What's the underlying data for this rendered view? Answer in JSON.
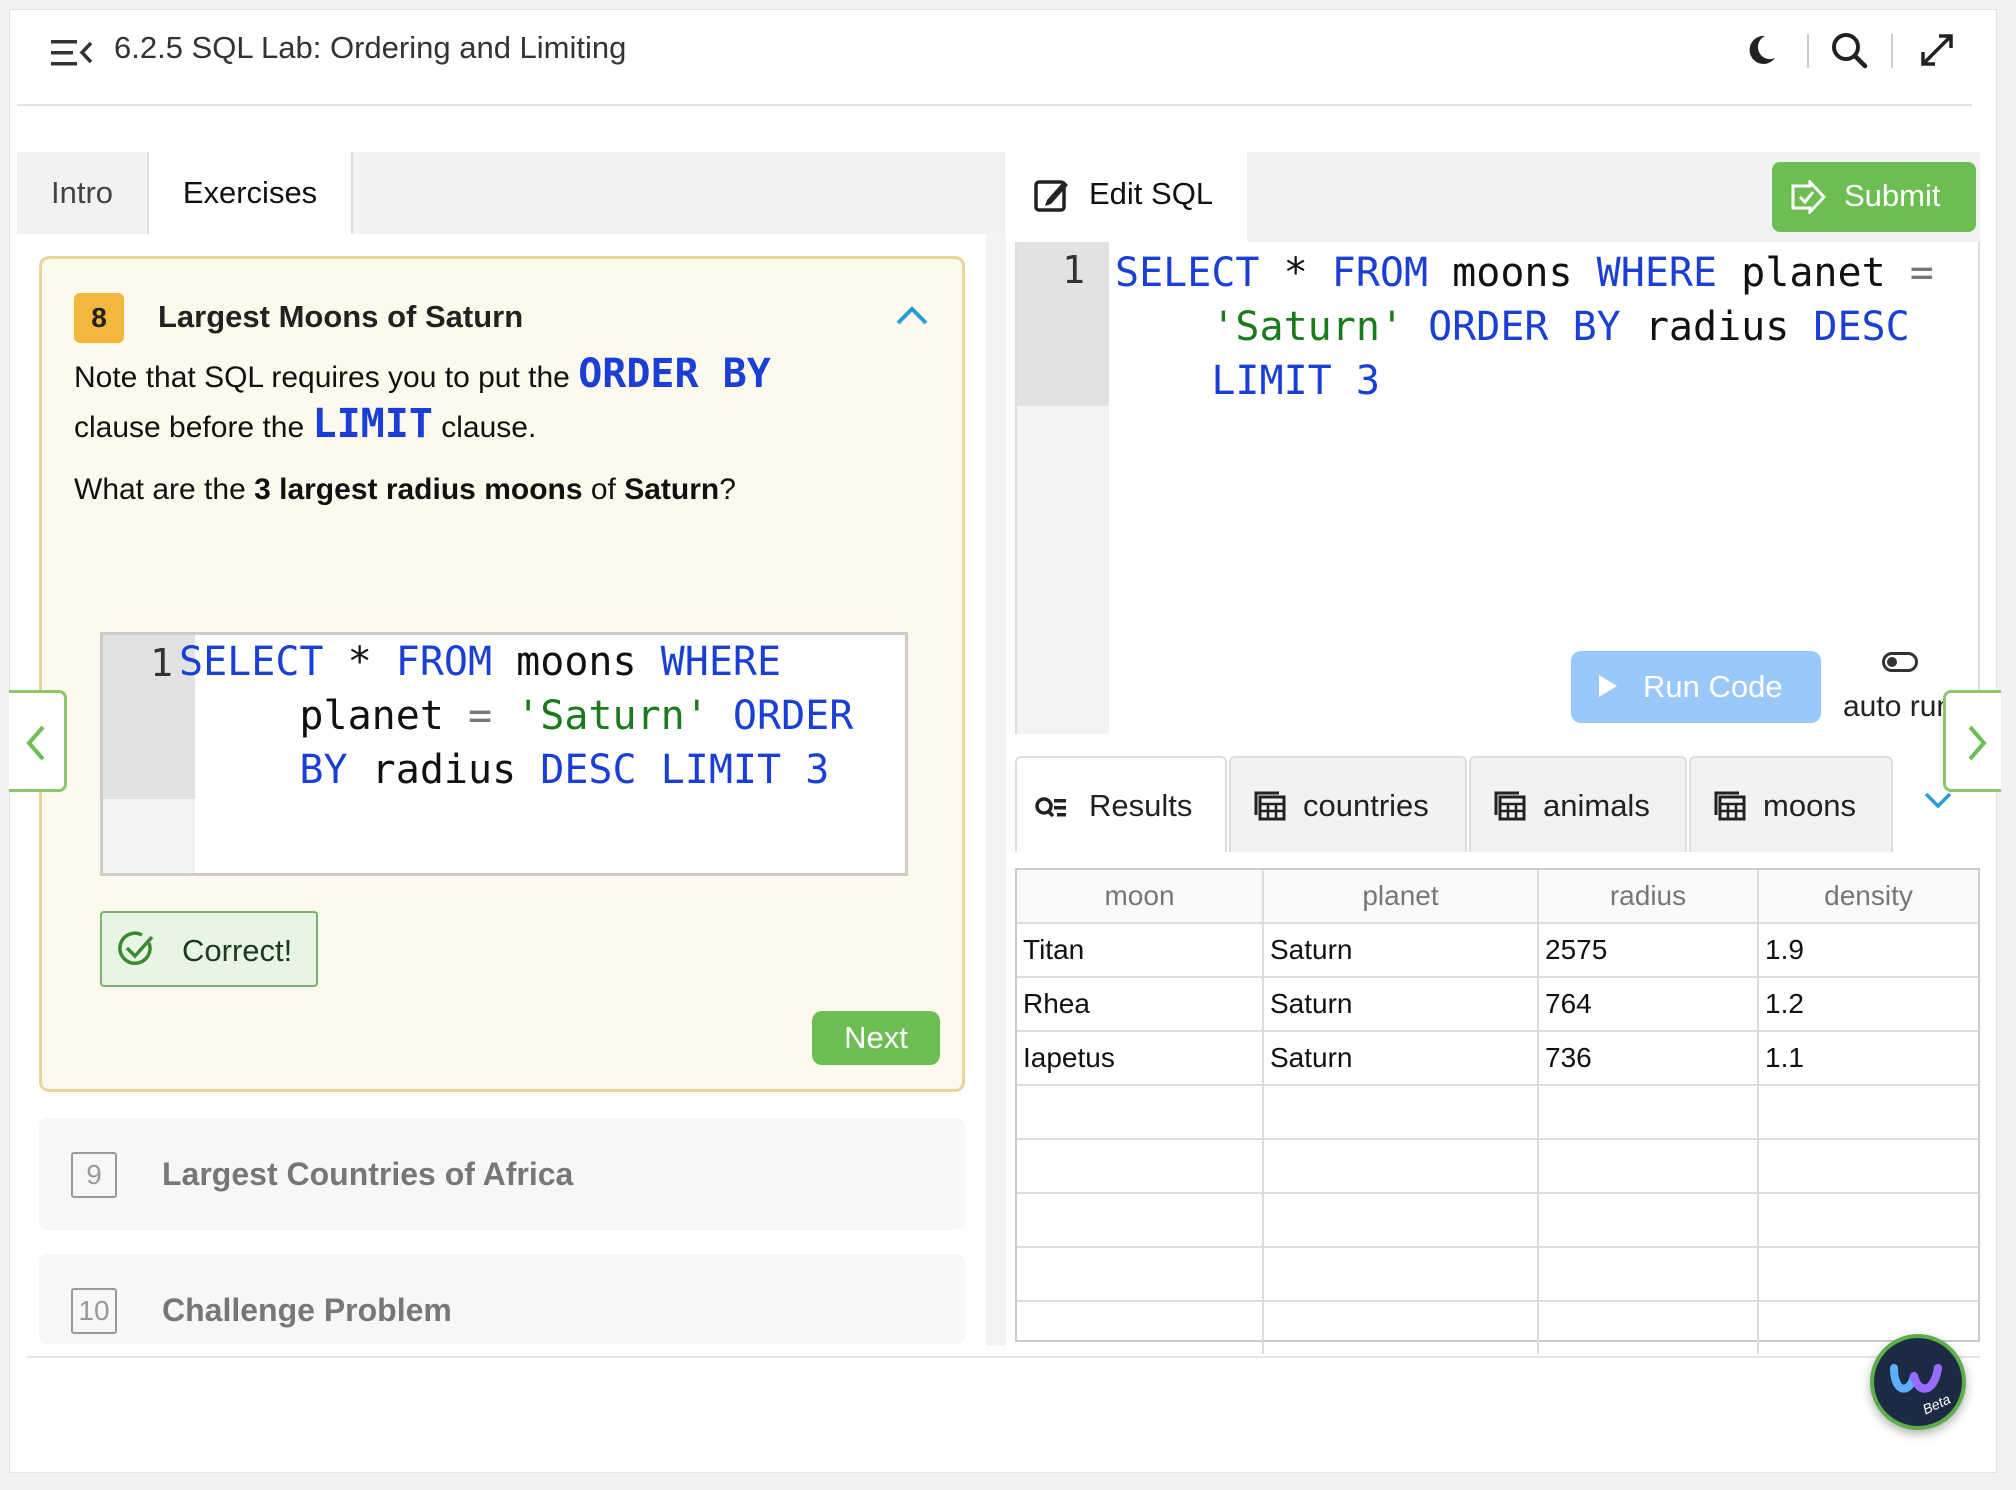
{
  "header": {
    "title": "6.2.5 SQL Lab: Ordering and Limiting",
    "icons": [
      "menu-collapse-icon",
      "moon-icon",
      "search-icon",
      "expand-icon"
    ]
  },
  "left_tabs": {
    "intro": "Intro",
    "exercises": "Exercises"
  },
  "exercise": {
    "number": "8",
    "title": "Largest Moons of Saturn",
    "para1_a": "Note that SQL requires you to put the ",
    "para1_kw1": "ORDER BY",
    "para1_b": "clause before the ",
    "para1_kw2": "LIMIT",
    "para1_c": " clause.",
    "question_a": "What are the ",
    "question_bold": "3 largest radius moons",
    "question_b": " of ",
    "question_bold2": "Saturn",
    "question_c": "?",
    "code_line_number": "1",
    "correct_label": "Correct!",
    "next_label": "Next"
  },
  "other_exercises": [
    {
      "number": "9",
      "title": "Largest Countries of Africa"
    },
    {
      "number": "10",
      "title": "Challenge Problem"
    }
  ],
  "editor": {
    "tab_label": "Edit SQL",
    "submit_label": "Submit",
    "line_number": "1",
    "query": "SELECT * FROM moons WHERE planet = 'Saturn' ORDER BY radius DESC LIMIT 3",
    "run_label": "Run Code",
    "auto_run_label": "auto run"
  },
  "result_tabs": [
    "Results",
    "countries",
    "animals",
    "moons"
  ],
  "results": {
    "columns": [
      "moon",
      "planet",
      "radius",
      "density"
    ],
    "rows": [
      [
        "Titan",
        "Saturn",
        "2575",
        "1.9"
      ],
      [
        "Rhea",
        "Saturn",
        "764",
        "1.2"
      ],
      [
        "Iapetus",
        "Saturn",
        "736",
        "1.1"
      ]
    ]
  },
  "assistant_badge": "Beta",
  "colors": {
    "accent_green": "#6cbe52",
    "keyword_blue": "#1a3fd6",
    "card_bg": "#fdf9ec",
    "run_blue": "#9ac8fa"
  }
}
